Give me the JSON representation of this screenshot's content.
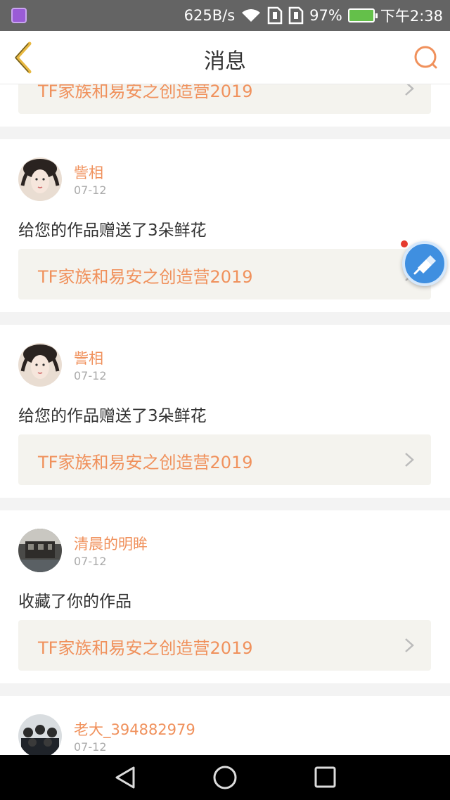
{
  "status_bar": {
    "net_speed": "625B/s",
    "battery": "97%",
    "time": "下午2:38"
  },
  "header": {
    "title": "消息"
  },
  "colors": {
    "accent": "#f0915c",
    "header_icon": "#f0915c",
    "card_link_bg": "#f4f3ee"
  },
  "partial_card": {
    "work_title": "TF家族和易安之创造营2019"
  },
  "messages": [
    {
      "username": "訾相",
      "date": "07-12",
      "action": "给您的作品赠送了3朵鲜花",
      "work_title": "TF家族和易安之创造营2019"
    },
    {
      "username": "訾相",
      "date": "07-12",
      "action": "给您的作品赠送了3朵鲜花",
      "work_title": "TF家族和易安之创造营2019"
    },
    {
      "username": "清晨的明眸",
      "date": "07-12",
      "action": "收藏了你的作品",
      "work_title": "TF家族和易安之创造营2019"
    },
    {
      "username": "老大_394882979",
      "date": "07-12"
    }
  ],
  "icons": {
    "back": "chevron-left-icon",
    "search": "search-icon",
    "float": "cleanup-broom-icon",
    "nav_back": "triangle-back-icon",
    "nav_home": "circle-home-icon",
    "nav_recent": "square-recent-icon"
  }
}
